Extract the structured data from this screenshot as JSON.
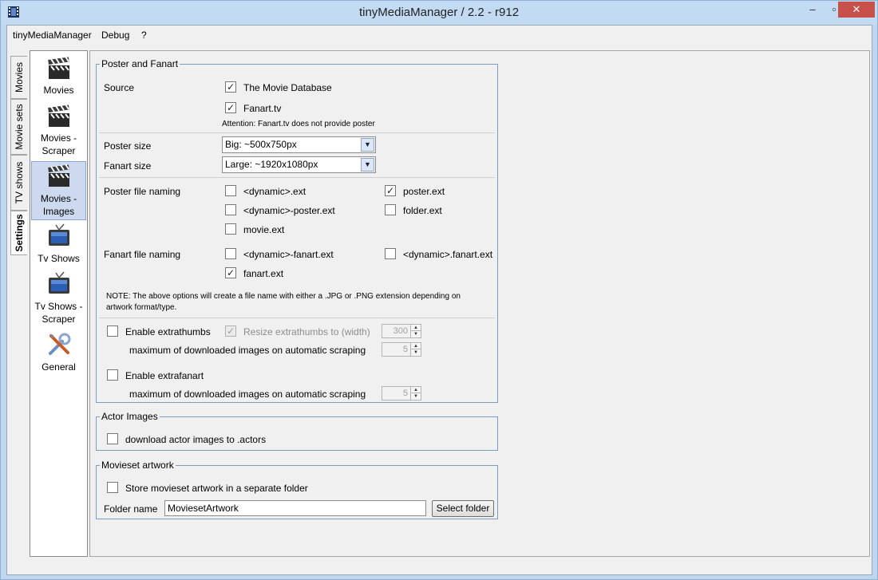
{
  "window": {
    "title": "tinyMediaManager / 2.2 - r912",
    "min": "–",
    "max": "▫",
    "close": "✕"
  },
  "menu": [
    "tinyMediaManager",
    "Debug",
    "?"
  ],
  "vtabs": [
    "Movies",
    "Movie sets",
    "TV shows",
    "Settings"
  ],
  "nav": [
    {
      "l1": "Movies",
      "l2": ""
    },
    {
      "l1": "Movies -",
      "l2": "Scraper"
    },
    {
      "l1": "Movies -",
      "l2": "Images"
    },
    {
      "l1": "Tv Shows",
      "l2": ""
    },
    {
      "l1": "Tv Shows -",
      "l2": "Scraper"
    },
    {
      "l1": "General",
      "l2": ""
    }
  ],
  "poster_fanart": {
    "title": "Poster and Fanart",
    "source_label": "Source",
    "source_tmdb": "The Movie Database",
    "source_fanarttv": "Fanart.tv",
    "attention": "Attention: Fanart.tv does not provide poster",
    "poster_size_label": "Poster size",
    "poster_size_value": "Big: ~500x750px",
    "fanart_size_label": "Fanart size",
    "fanart_size_value": "Large: ~1920x1080px",
    "poster_naming_label": "Poster file naming",
    "poster_opts": [
      "<dynamic>.ext",
      "poster.ext",
      "<dynamic>-poster.ext",
      "folder.ext",
      "movie.ext"
    ],
    "fanart_naming_label": "Fanart file naming",
    "fanart_opts": [
      "<dynamic>-fanart.ext",
      "<dynamic>.fanart.ext",
      "fanart.ext"
    ],
    "note_line1": "NOTE: The above options will create a file name with either a .JPG or .PNG extension depending on",
    "note_line2": "artwork format/type.",
    "enable_extrathumbs": "Enable extrathumbs",
    "resize_extrathumbs": "Resize extrathumbs to (width)",
    "resize_width": "300",
    "max_downloaded_1": "maximum of downloaded images on automatic scraping",
    "max_value_1": "5",
    "enable_extrafanart": "Enable extrafanart",
    "max_downloaded_2": "maximum of downloaded images on automatic scraping",
    "max_value_2": "5"
  },
  "actor_images": {
    "title": "Actor Images",
    "download_actors": "download actor images to .actors"
  },
  "movieset_artwork": {
    "title": "Movieset artwork",
    "store_separate": "Store movieset artwork in a separate folder",
    "folder_name_label": "Folder name",
    "folder_name_value": "MoviesetArtwork",
    "select_folder": "Select folder"
  },
  "check": "✓"
}
